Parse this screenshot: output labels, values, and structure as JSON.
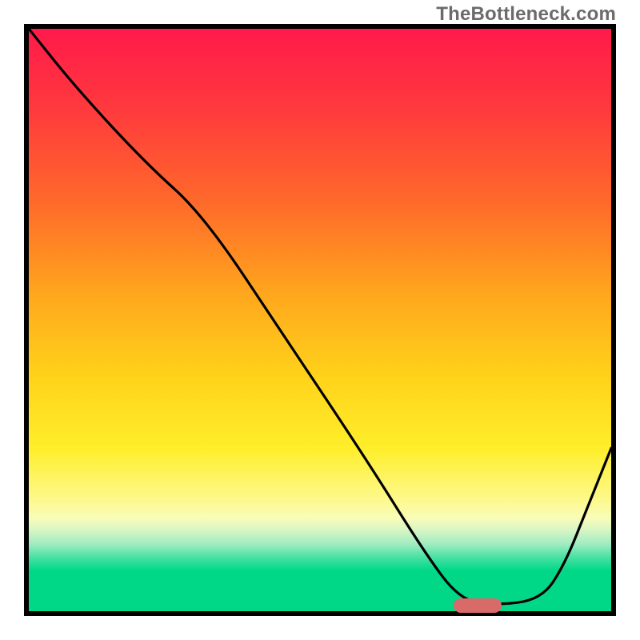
{
  "watermark": "TheBottleneck.com",
  "chart_data": {
    "type": "line",
    "title": "",
    "xlabel": "",
    "ylabel": "",
    "xlim": [
      0,
      100
    ],
    "ylim": [
      0,
      100
    ],
    "grid": false,
    "series": [
      {
        "name": "bottleneck-curve",
        "color": "#000000",
        "x": [
          0,
          8,
          20,
          30,
          44,
          58,
          68,
          74,
          80,
          88,
          92,
          96,
          100
        ],
        "values": [
          100,
          90,
          77,
          68,
          47,
          26,
          10,
          2,
          1,
          2,
          8,
          18,
          28
        ]
      }
    ],
    "marker": {
      "x": 77,
      "y": 1,
      "color": "#d86a6a"
    },
    "gradient_stops": [
      {
        "pos": 0,
        "color": "#ff1a4b"
      },
      {
        "pos": 14,
        "color": "#ff3a3d"
      },
      {
        "pos": 30,
        "color": "#ff6a2a"
      },
      {
        "pos": 46,
        "color": "#ffa81d"
      },
      {
        "pos": 60,
        "color": "#ffd31a"
      },
      {
        "pos": 72,
        "color": "#ffee2a"
      },
      {
        "pos": 81,
        "color": "#fdf98e"
      },
      {
        "pos": 84,
        "color": "#f9fcb8"
      },
      {
        "pos": 86,
        "color": "#d9f6c4"
      },
      {
        "pos": 88.5,
        "color": "#9fecc1"
      },
      {
        "pos": 91,
        "color": "#3fe0a0"
      },
      {
        "pos": 93,
        "color": "#00d888"
      },
      {
        "pos": 100,
        "color": "#00d888"
      }
    ]
  }
}
